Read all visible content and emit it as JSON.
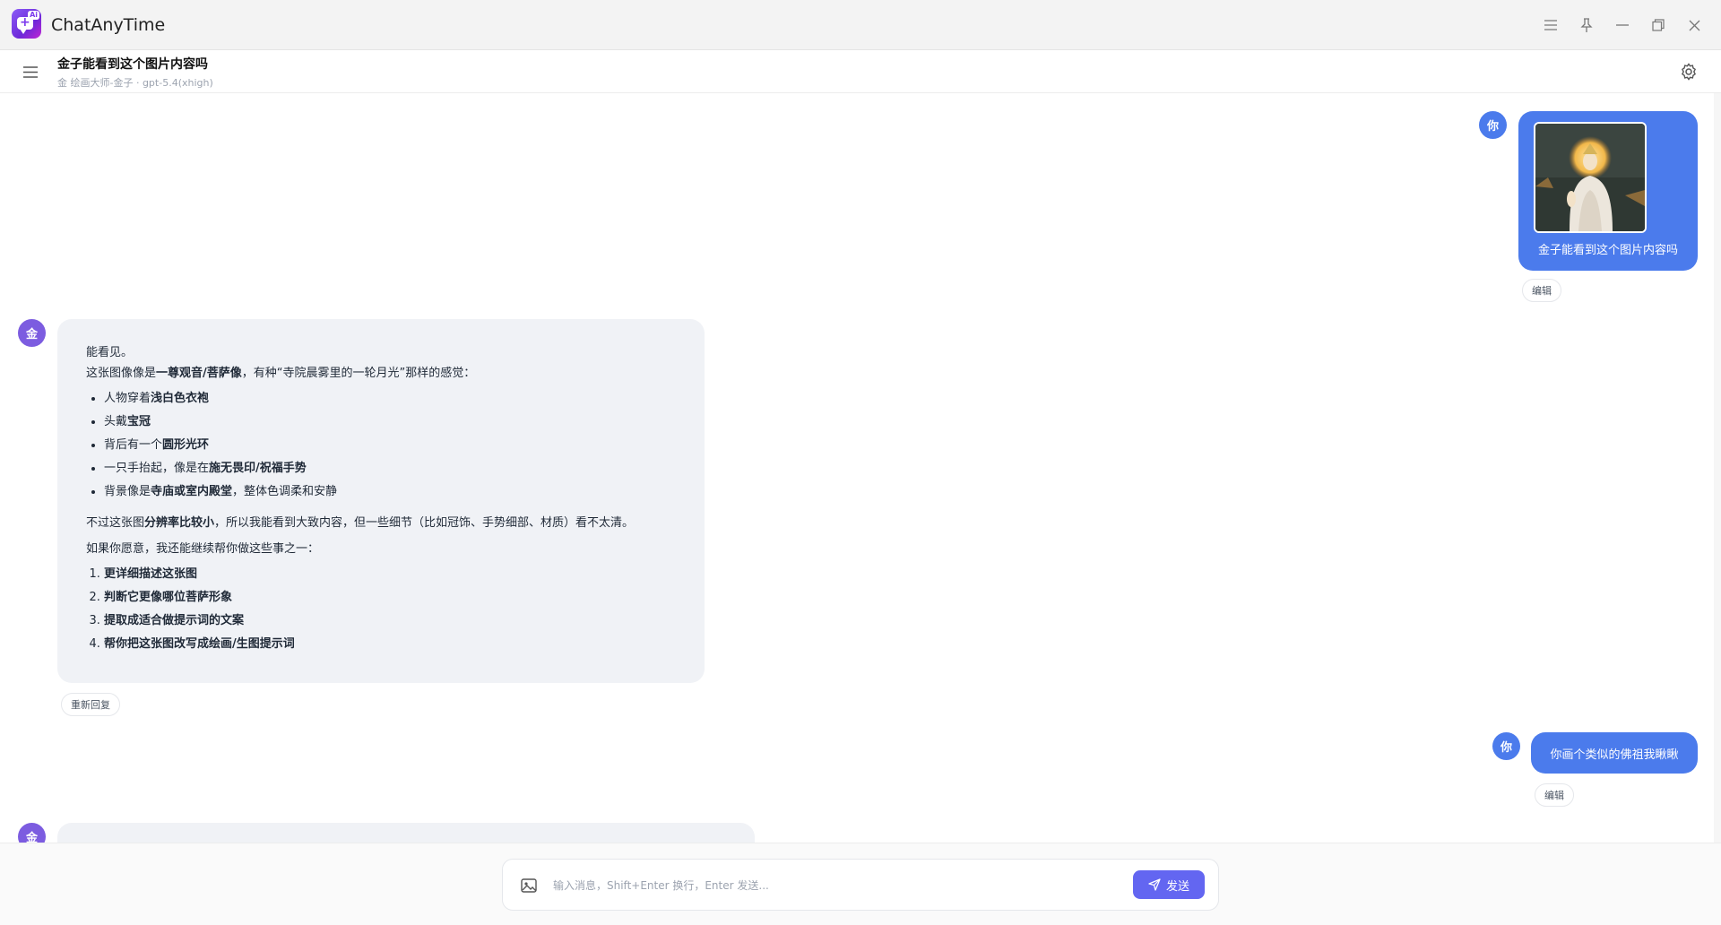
{
  "app": {
    "title": "ChatAnyTime",
    "logo_tag": "Ai"
  },
  "header": {
    "chat_title": "金子能看到这个图片内容吗",
    "chat_subtitle": "金 绘画大师-金子 · gpt-5.4(xhigh)"
  },
  "messages": {
    "user1": {
      "avatar": "你",
      "text": "金子能看到这个图片内容吗",
      "edit_label": "编辑"
    },
    "bot1": {
      "avatar": "金",
      "p1": "能看见。",
      "p2a": "这张图像像是",
      "p2b": "一尊观音/菩萨像",
      "p2c": "，有种“寺院晨雾里的一轮月光”那样的感觉：",
      "bullets": [
        {
          "pre": "人物穿着",
          "bold": "浅白色衣袍",
          "post": ""
        },
        {
          "pre": "头戴",
          "bold": "宝冠",
          "post": ""
        },
        {
          "pre": "背后有一个",
          "bold": "圆形光环",
          "post": ""
        },
        {
          "pre": "一只手抬起，像是在",
          "bold": "施无畏印/祝福手势",
          "post": ""
        },
        {
          "pre": "背景像是",
          "bold": "寺庙或室内殿堂",
          "post": "，整体色调柔和安静"
        }
      ],
      "p3a": "不过这张图",
      "p3b": "分辨率比较小",
      "p3c": "，所以我能看到大致内容，但一些细节（比如冠饰、手势细部、材质）看不太清。",
      "p4": "如果你愿意，我还能继续帮你做这些事之一：",
      "options": [
        "更详细描述这张图",
        "判断它更像哪位菩萨形象",
        "提取成适合做提示词的文案",
        "帮你把这张图改写成绘画/生图提示词"
      ],
      "regen_label": "重新回复"
    },
    "user2": {
      "avatar": "你",
      "text": "你画个类似的佛祖我瞅瞅",
      "edit_label": "编辑"
    },
    "bot2": {
      "avatar": "金"
    }
  },
  "composer": {
    "placeholder": "输入消息，Shift+Enter 换行，Enter 发送...",
    "send_label": "发送"
  },
  "colors": {
    "user_bubble": "#4b7bec",
    "bot_avatar": "#7c5ce0",
    "send_button": "#6366f1",
    "bot_bubble": "#f0f2f6"
  }
}
